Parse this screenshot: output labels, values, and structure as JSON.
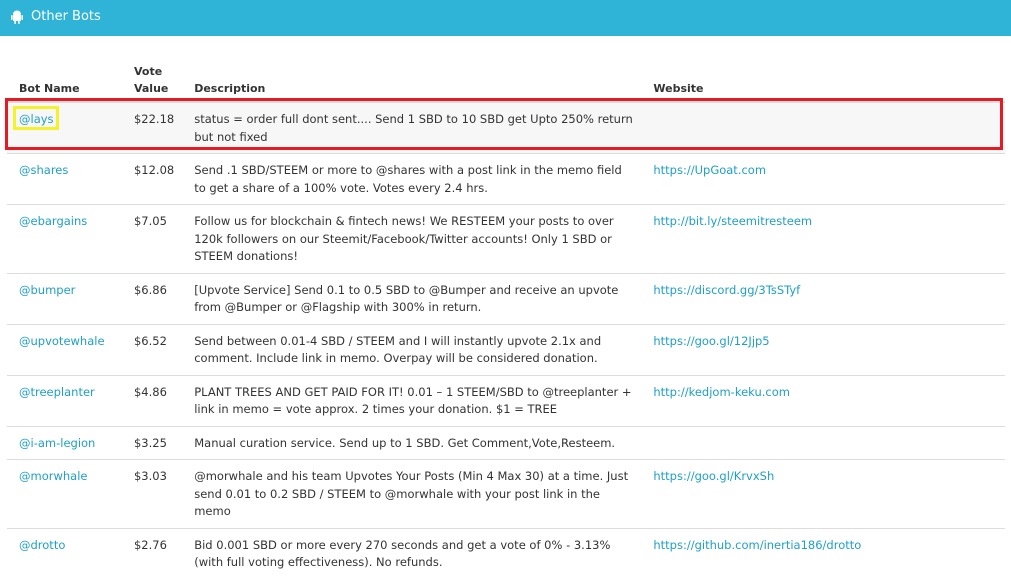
{
  "panel": {
    "title": "Other Bots"
  },
  "table": {
    "headers": {
      "name": "Bot Name",
      "vote": "Vote Value",
      "desc": "Description",
      "site": "Website"
    },
    "rows": [
      {
        "name": "@lays",
        "vote": "$22.18",
        "desc": "status = order full dont sent.... Send 1 SBD to 10 SBD get Upto 250% return but not fixed",
        "site": ""
      },
      {
        "name": "@shares",
        "vote": "$12.08",
        "desc": "Send .1 SBD/STEEM or more to @shares with a post link in the memo field to get a share of a 100% vote. Votes every 2.4 hrs.",
        "site": "https://UpGoat.com"
      },
      {
        "name": "@ebargains",
        "vote": "$7.05",
        "desc": "Follow us for blockchain & fintech news! We RESTEEM your posts to over 120k followers on our Steemit/Facebook/Twitter accounts! Only 1 SBD or STEEM donations!",
        "site": "http://bit.ly/steemitresteem"
      },
      {
        "name": "@bumper",
        "vote": "$6.86",
        "desc": "[Upvote Service] Send 0.1 to 0.5 SBD to @Bumper and receive an upvote from @Bumper or @Flagship with 300% in return.",
        "site": "https://discord.gg/3TsSTyf"
      },
      {
        "name": "@upvotewhale",
        "vote": "$6.52",
        "desc": "Send between 0.01-4 SBD / STEEM and I will instantly upvote 2.1x and comment. Include link in memo. Overpay will be considered donation.",
        "site": "https://goo.gl/12Jjp5"
      },
      {
        "name": "@treeplanter",
        "vote": "$4.86",
        "desc": "PLANT TREES AND GET PAID FOR IT! 0.01 – 1 STEEM/SBD to @treeplanter + link in memo = vote approx. 2 times your donation. $1 = TREE",
        "site": "http://kedjom-keku.com"
      },
      {
        "name": "@i-am-legion",
        "vote": "$3.25",
        "desc": "Manual curation service. Send up to 1 SBD. Get Comment,Vote,Resteem.",
        "site": ""
      },
      {
        "name": "@morwhale",
        "vote": "$3.03",
        "desc": "@morwhale and his team Upvotes Your Posts (Min 4 Max 30) at a time. Just send 0.01 to 0.2 SBD / STEEM to @morwhale with your post link in the memo",
        "site": "https://goo.gl/KrvxSh"
      },
      {
        "name": "@drotto",
        "vote": "$2.76",
        "desc": "Bid 0.001 SBD or more every 270 seconds and get a vote of 0% - 3.13% (with full voting effectiveness). No refunds.",
        "site": "https://github.com/inertia186/drotto"
      }
    ]
  },
  "colors": {
    "header_bar": "#2fb3d6",
    "link": "#1f9fc6",
    "highlight_row": "#e41b23",
    "highlight_name": "#f5f12a"
  },
  "icons": {
    "panel_icon": "android-icon"
  }
}
